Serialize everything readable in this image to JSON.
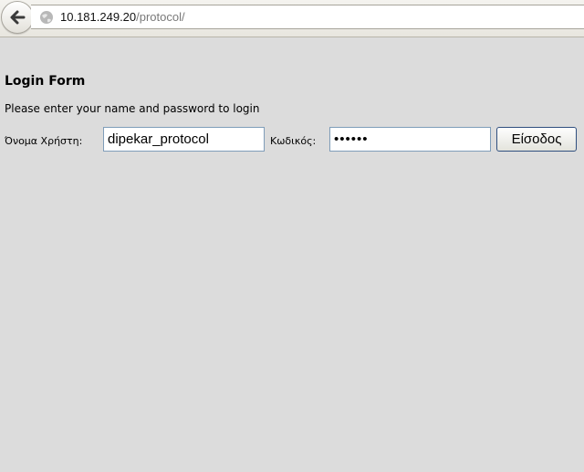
{
  "browser": {
    "back_icon": "back-arrow-icon",
    "site_icon": "globe-icon",
    "url_host": "10.181.249.20",
    "url_path": "/protocol/"
  },
  "form": {
    "title": "Login Form",
    "subtitle": "Please enter your name and password to login",
    "username_label": "Όνομα Χρήστη:",
    "username_value": "dipekar_protocol",
    "password_label": "Κωδικός:",
    "password_value": "••••••",
    "submit_label": "Είσοδος"
  }
}
